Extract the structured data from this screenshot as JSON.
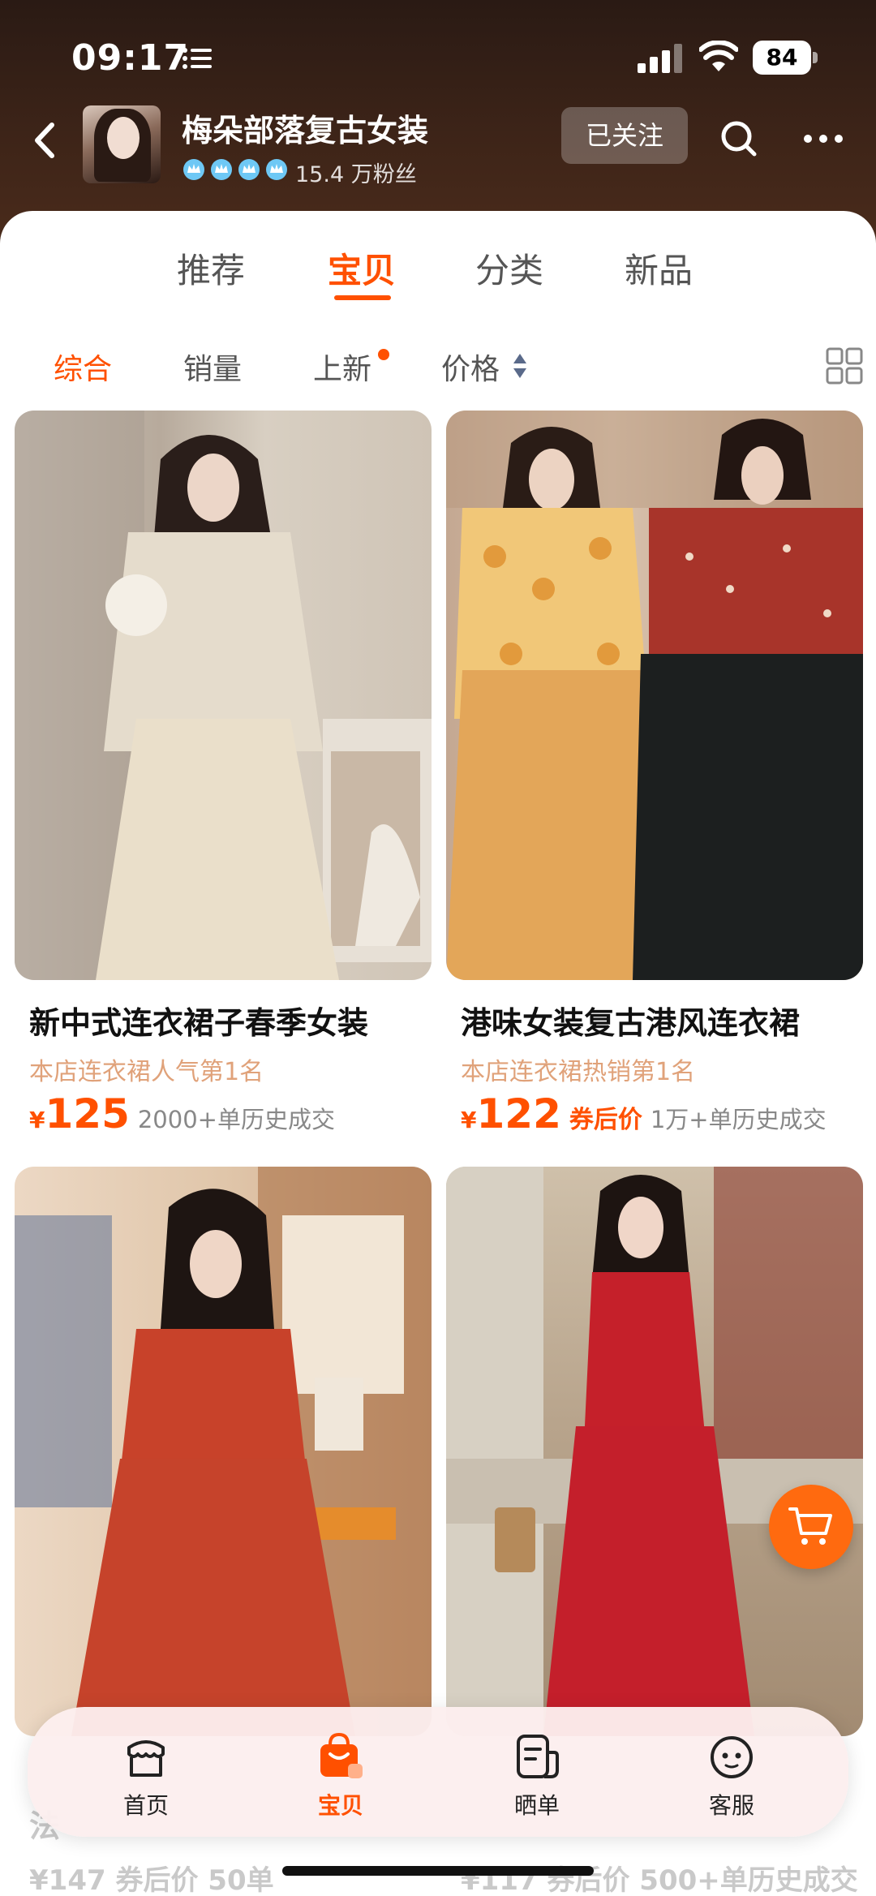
{
  "status_bar": {
    "time": "09:17",
    "battery": "84"
  },
  "shop": {
    "name": "梅朵部落复古女装",
    "fans": "15.4 万粉丝",
    "follow_label": "已关注"
  },
  "tabs": [
    {
      "label": "推荐",
      "active": false
    },
    {
      "label": "宝贝",
      "active": true
    },
    {
      "label": "分类",
      "active": false
    },
    {
      "label": "新品",
      "active": false
    }
  ],
  "filters": [
    {
      "label": "综合",
      "active": true
    },
    {
      "label": "销量",
      "active": false
    },
    {
      "label": "上新",
      "active": false
    },
    {
      "label": "价格",
      "active": false
    }
  ],
  "products": [
    {
      "title": "新中式连衣裙子春季女装",
      "rank": "本店连衣裙人气第1名",
      "currency": "¥",
      "price": "125",
      "coupon_label": "",
      "sold": "2000+单历史成交"
    },
    {
      "title": "港味女装复古港风连衣裙",
      "rank": "本店连衣裙热销第1名",
      "currency": "¥",
      "price": "122",
      "coupon_label": "券后价",
      "sold": "1万+单历史成交"
    }
  ],
  "partial_row": {
    "left_title": "法",
    "left_price": "¥147 券后价 50单",
    "right_price": "¥117 券后价 500+单历史成交"
  },
  "bottom_nav": [
    {
      "label": "首页",
      "icon": "shop-home-icon",
      "active": false
    },
    {
      "label": "宝贝",
      "icon": "shopping-bag-icon",
      "active": true
    },
    {
      "label": "晒单",
      "icon": "review-icon",
      "active": false
    },
    {
      "label": "客服",
      "icon": "customer-service-icon",
      "active": false
    }
  ],
  "colors": {
    "accent": "#ff5000",
    "header_bg": "#3d2418",
    "rank_text": "#e0a27a"
  }
}
